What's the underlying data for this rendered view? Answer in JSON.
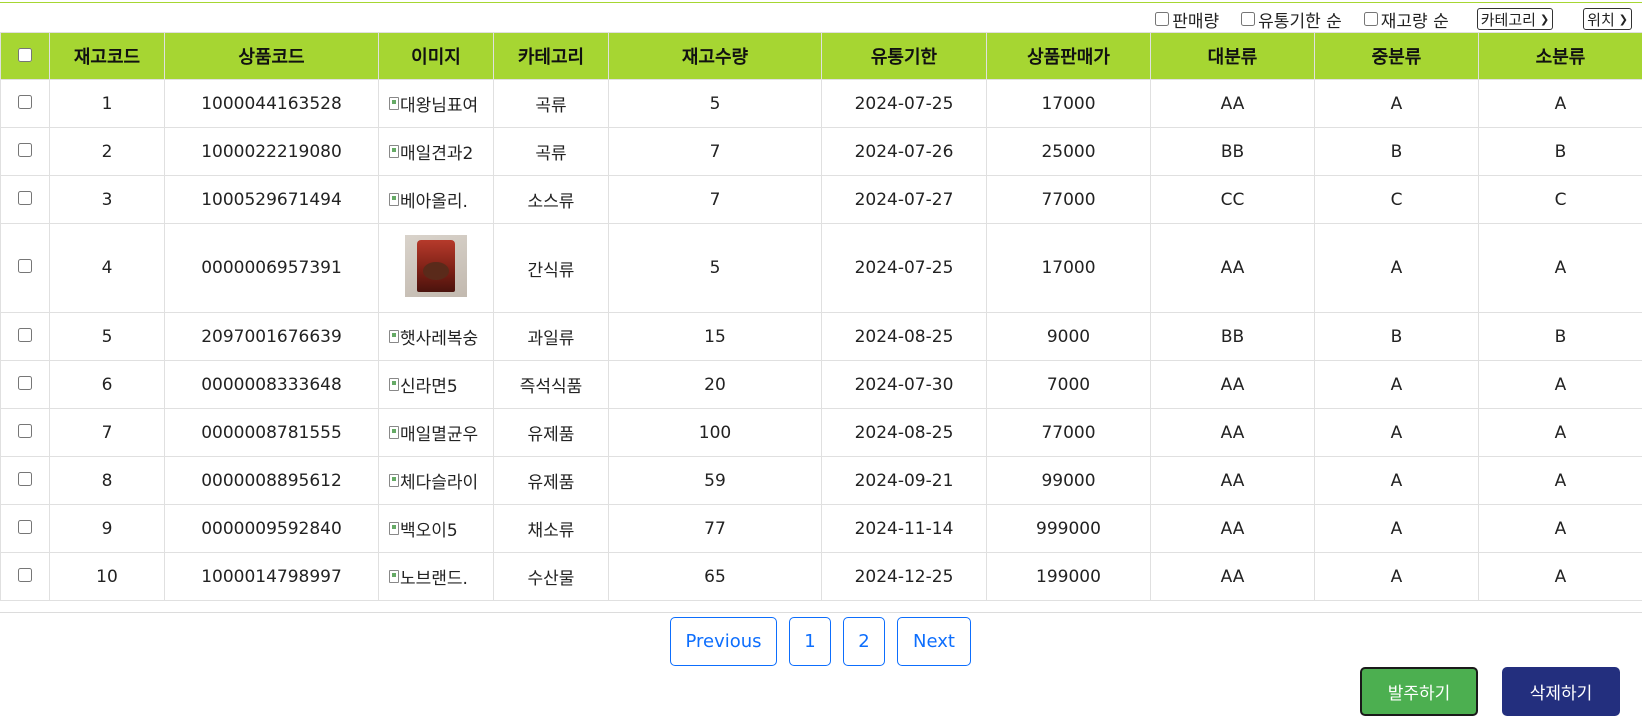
{
  "filters": {
    "sales_label": "판매량",
    "expiry_label": "유통기한 순",
    "stock_label": "재고량 순",
    "category_select": "카테고리",
    "location_select": "위치"
  },
  "table": {
    "headers": [
      "재고코드",
      "상품코드",
      "이미지",
      "카테고리",
      "재고수량",
      "유통기한",
      "상품판매가",
      "대분류",
      "중분류",
      "소분류"
    ],
    "rows": [
      {
        "code": "1",
        "product": "1000044163528",
        "img": "대왕님표여",
        "category": "곡류",
        "qty": "5",
        "expiry": "2024-07-25",
        "price": "17000",
        "major": "AA",
        "middle": "A",
        "minor": "A"
      },
      {
        "code": "2",
        "product": "1000022219080",
        "img": "매일견과2",
        "category": "곡류",
        "qty": "7",
        "expiry": "2024-07-26",
        "price": "25000",
        "major": "BB",
        "middle": "B",
        "minor": "B"
      },
      {
        "code": "3",
        "product": "1000529671494",
        "img": "베아올리.",
        "category": "소스류",
        "qty": "7",
        "expiry": "2024-07-27",
        "price": "77000",
        "major": "CC",
        "middle": "C",
        "minor": "C"
      },
      {
        "code": "4",
        "product": "0000006957391",
        "img": "",
        "category": "간식류",
        "qty": "5",
        "expiry": "2024-07-25",
        "price": "17000",
        "major": "AA",
        "middle": "A",
        "minor": "A"
      },
      {
        "code": "5",
        "product": "2097001676639",
        "img": "햇사레복숭",
        "category": "과일류",
        "qty": "15",
        "expiry": "2024-08-25",
        "price": "9000",
        "major": "BB",
        "middle": "B",
        "minor": "B"
      },
      {
        "code": "6",
        "product": "0000008333648",
        "img": "신라면5",
        "category": "즉석식품",
        "qty": "20",
        "expiry": "2024-07-30",
        "price": "7000",
        "major": "AA",
        "middle": "A",
        "minor": "A"
      },
      {
        "code": "7",
        "product": "0000008781555",
        "img": "매일멸균우",
        "category": "유제품",
        "qty": "100",
        "expiry": "2024-08-25",
        "price": "77000",
        "major": "AA",
        "middle": "A",
        "minor": "A"
      },
      {
        "code": "8",
        "product": "0000008895612",
        "img": "체다슬라이",
        "category": "유제품",
        "qty": "59",
        "expiry": "2024-09-21",
        "price": "99000",
        "major": "AA",
        "middle": "A",
        "minor": "A"
      },
      {
        "code": "9",
        "product": "0000009592840",
        "img": "백오이5",
        "category": "채소류",
        "qty": "77",
        "expiry": "2024-11-14",
        "price": "999000",
        "major": "AA",
        "middle": "A",
        "minor": "A"
      },
      {
        "code": "10",
        "product": "1000014798997",
        "img": "노브랜드.",
        "category": "수산물",
        "qty": "65",
        "expiry": "2024-12-25",
        "price": "199000",
        "major": "AA",
        "middle": "A",
        "minor": "A"
      }
    ]
  },
  "pagination": {
    "prev": "Previous",
    "pages": [
      "1",
      "2"
    ],
    "next": "Next"
  },
  "actions": {
    "order": "발주하기",
    "delete": "삭제하기"
  },
  "colors": {
    "header_bg": "#a6d632",
    "order_btn": "#4caf50",
    "delete_btn": "#232f7e",
    "link": "#0d6efd"
  }
}
